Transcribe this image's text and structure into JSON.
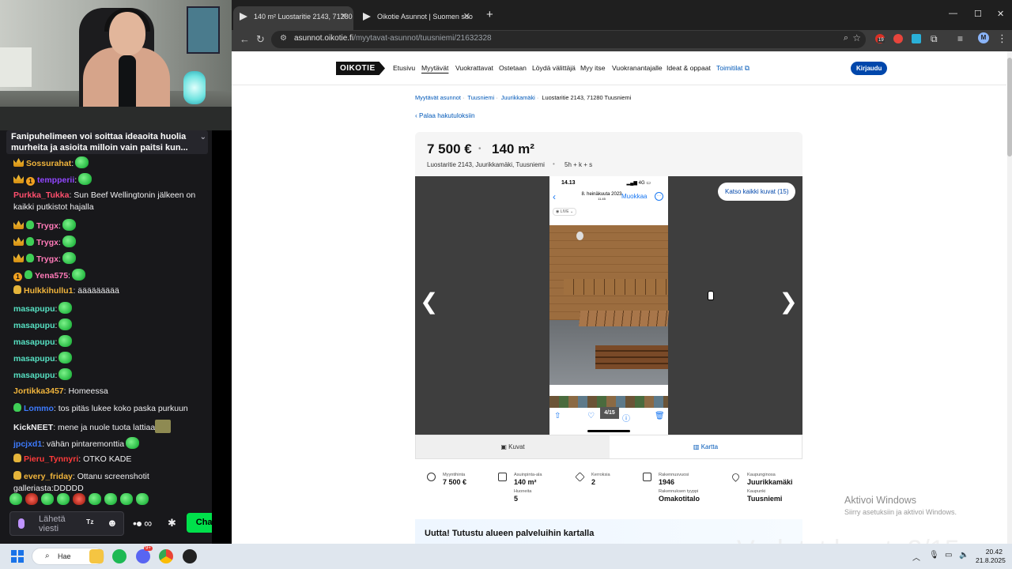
{
  "chat": {
    "pinned": "Fanipuhelimeen voi soittaa ideaoita huolia murheita ja asioita milloin vain paitsi kun...",
    "messages": [
      {
        "user": "Sossurahat",
        "text": ":",
        "color": "#f0b43c"
      },
      {
        "user": "tempperii",
        "text": ":",
        "color": "#9147ff",
        "num": "1"
      },
      {
        "user": "Purkka_Tukka",
        "text": ": Sun Beef Wellingtonin jälkeen on kaikki putkistot hajalla",
        "color": "#ff4f6d"
      },
      {
        "user": "Trygx",
        "text": ":",
        "color": "#ff7ab8"
      },
      {
        "user": "Trygx",
        "text": ":",
        "color": "#ff7ab8"
      },
      {
        "user": "Trygx",
        "text": ":",
        "color": "#ff7ab8"
      },
      {
        "user": "Yena575",
        "text": ":",
        "color": "#ff7ab8",
        "num": "1"
      },
      {
        "user": "Hulkkihullu1",
        "text": ": äääääääää",
        "color": "#f0b43c"
      },
      {
        "user": "masapupu",
        "text": ":",
        "color": "#56e0c2"
      },
      {
        "user": "masapupu",
        "text": ":",
        "color": "#56e0c2"
      },
      {
        "user": "masapupu",
        "text": ":",
        "color": "#56e0c2"
      },
      {
        "user": "masapupu",
        "text": ":",
        "color": "#56e0c2"
      },
      {
        "user": "masapupu",
        "text": ":",
        "color": "#56e0c2"
      },
      {
        "user": "Jortikka3457",
        "text": ": Homeessa",
        "color": "#f0b43c"
      },
      {
        "user": "Lommo",
        "text": ": tos pitäs lukee koko paska purkuun",
        "color": "#3d7bff"
      },
      {
        "user": "KickNEET",
        "text": ": mene ja nuole tuota lattiaa",
        "color": "#efeff1"
      },
      {
        "user": "jpcjxd1",
        "text": ": vähän pintaremonttia",
        "color": "#3d7bff"
      },
      {
        "user": "Pieru_Tynnyri",
        "text": ": OTKO KADE",
        "color": "#ff3b3b"
      },
      {
        "user": "every_friday",
        "text": ": Ottanu screenshotit galleriasta:DDDDD",
        "color": "#f0b43c"
      }
    ],
    "input_placeholder": "Lähetä viesti",
    "chat_button": "Chat"
  },
  "browser": {
    "tabs": [
      {
        "title": "140 m² Luostaritie 2143, 71280",
        "active": true
      },
      {
        "title": "Oikotie Asunnot | Suomen suo",
        "active": false
      }
    ],
    "url_host": "asunnot.oikotie.fi",
    "url_path": "/myytavat-asunnot/tuusniemi/21632328",
    "ext_badge": "19",
    "profile_initial": "M"
  },
  "site": {
    "logo": "OIKOTIE",
    "nav": [
      "Etusivu",
      "Myytävät",
      "Vuokrattavat",
      "Ostetaan",
      "Löydä välittäjä",
      "Myy itse",
      "Vuokranantajalle",
      "Ideat & oppaat"
    ],
    "nav_active": "Myytävät",
    "nav_editorial": "Toimitilat",
    "login": "Kirjaudu",
    "breadcrumbs": [
      "Myytävät asunnot",
      "Tuusniemi",
      "Juurikkamäki"
    ],
    "breadcrumb_current": "Luostaritie 2143, 71280 Tuusniemi",
    "back_link": "Palaa hakutuloksiin"
  },
  "listing": {
    "price": "7 500 €",
    "area": "140 m²",
    "address": "Luostaritie 2143, Juurikkamäki, Tuusniemi",
    "rooms": "5h + k + s",
    "all_photos_button": "Katso kaikki kuvat (15)",
    "photo": {
      "time": "14.13",
      "signal": "4G",
      "date_line1": "8. heinäkuuta 2023",
      "date_line2": "11.45",
      "edit": "Muokkaa",
      "live": "LIVE",
      "counter": "4/15"
    },
    "tab_photos": "Kuvat",
    "tab_map": "Kartta",
    "facts": [
      {
        "label": "Myyntihinta",
        "value": "7 500 €"
      },
      {
        "label": "Asuinpinta-ala",
        "value": "140 m²"
      },
      {
        "label": "Huoneita",
        "value": "5"
      },
      {
        "label": "Kerroksia",
        "value": "2"
      },
      {
        "label": "Rakennusvuosi",
        "value": "1946"
      },
      {
        "label": "Rakennuksen tyyppi",
        "value": "Omakotitalo"
      },
      {
        "label": "Kaupunginosa",
        "value": "Juurikkamäki"
      },
      {
        "label": "Kaupunki",
        "value": "Tuusniemi"
      }
    ],
    "map_promo": "Uutta! Tutustu alueen palveluihin kartalla"
  },
  "os": {
    "activate_title": "Aktivoi Windows",
    "activate_sub": "Siirry asetuksiin ja aktivoi Windows.",
    "watermark": "Vedetyt leuat: 2/15",
    "search": "Hae",
    "time": "20.42",
    "date": "21.8.2025",
    "discord_badge": "9+"
  }
}
